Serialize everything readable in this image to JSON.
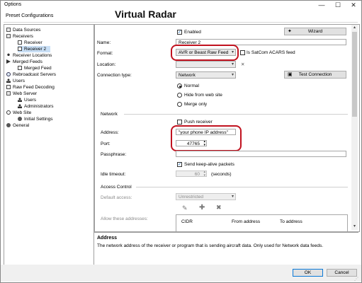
{
  "window": {
    "title": "Options",
    "minimize": "—",
    "maximize": "☐",
    "close": "✕"
  },
  "header": {
    "section": "Preset Configurations",
    "annotation": "Virtual Radar"
  },
  "tree": [
    {
      "label": "Data Sources",
      "icon": "grid-icon"
    },
    {
      "label": "Receivers",
      "icon": "grid-icon"
    },
    {
      "label": "Receiver",
      "icon": "document-icon"
    },
    {
      "label": "Receiver 2",
      "icon": "document-icon"
    },
    {
      "label": "Receiver Locations",
      "icon": "pin-icon"
    },
    {
      "label": "Merged Feeds",
      "icon": "merge-icon"
    },
    {
      "label": "Merged Feed",
      "icon": "document-icon"
    },
    {
      "label": "Rebroadcast Servers",
      "icon": "network-icon"
    },
    {
      "label": "Users",
      "icon": "user-icon"
    },
    {
      "label": "Raw Feed Decoding",
      "icon": "document-icon"
    },
    {
      "label": "Web Server",
      "icon": "grid-icon"
    },
    {
      "label": "Users",
      "icon": "user-icon"
    },
    {
      "label": "Administrators",
      "icon": "user-icon"
    },
    {
      "label": "Web Site",
      "icon": "globe-icon"
    },
    {
      "label": "Initial Settings",
      "icon": "gear-icon"
    },
    {
      "label": "General",
      "icon": "gear-icon"
    }
  ],
  "form": {
    "enabled_label": "Enabled",
    "enabled_check": "✓",
    "wizard_label": "Wizard",
    "name_label": "Name:",
    "name_value": "Receiver 2",
    "format_label": "Format:",
    "format_value": "AVR or Beast Raw Feed",
    "satcom_label": "Is SatCom ACARS feed",
    "location_label": "Location:",
    "location_value": "",
    "location_clear": "✕",
    "conn_type_label": "Connection type:",
    "conn_type_value": "Network",
    "test_conn_label": "Test Connection",
    "radio_normal": "Normal",
    "radio_hide": "Hide from web site",
    "radio_merge": "Merge only",
    "network_heading": "Network",
    "push_receiver_label": "Push receiver",
    "address_label": "Address:",
    "address_value": "\"your phone IP address\"",
    "port_label": "Port:",
    "port_value": "47765",
    "passphrase_label": "Passphrase:",
    "passphrase_value": "",
    "keepalive_label": "Send keep-alive packets",
    "keepalive_check": "✓",
    "idle_label": "Idle timeout:",
    "idle_value": "60",
    "idle_unit": "(seconds)",
    "access_heading": "Access Control",
    "default_access_label": "Default access:",
    "default_access_value": "Unrestricted",
    "allow_label": "Allow these addresses:",
    "table_headers": [
      "CIDR",
      "From address",
      "To address"
    ]
  },
  "description": {
    "title": "Address",
    "text": "The network address of the receiver or program that is sending aircraft data. Only used for Network data feeds."
  },
  "footer": {
    "ok": "OK",
    "cancel": "Cancel"
  },
  "colors": {
    "highlight": "#c1121f",
    "selection": "#c9dff5"
  }
}
